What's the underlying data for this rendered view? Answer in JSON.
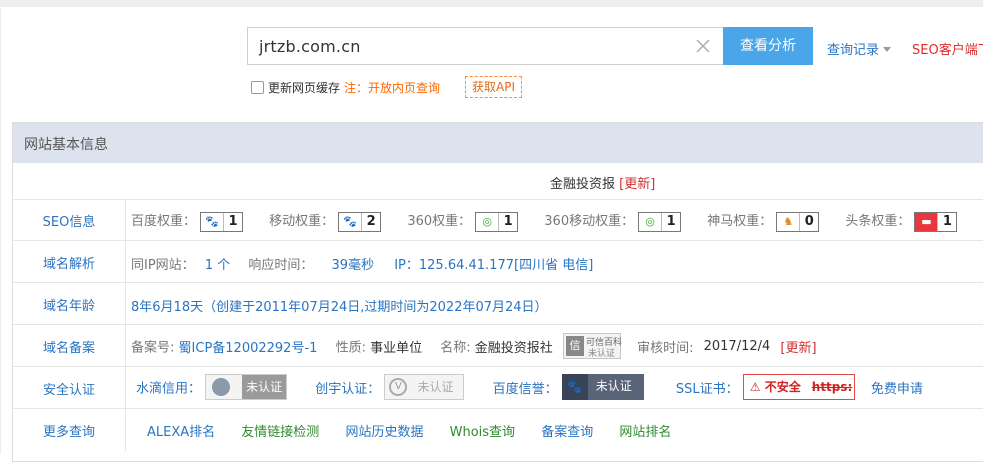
{
  "search": {
    "value": "jrtzb.com.cn",
    "button": "查看分析",
    "history": "查询记录",
    "seo_client": "SEO客户端下"
  },
  "options": {
    "refresh_cache": "更新网页缓存",
    "note": "注：开放内页查询",
    "api": "获取API"
  },
  "panel": {
    "title": "网站基本信息",
    "site_name": "金融投资报",
    "update": "[更新]",
    "rows": {
      "seo": {
        "label": "SEO信息",
        "items": [
          {
            "name": "百度权重：",
            "icon": "baidu-paw-icon",
            "value": "1"
          },
          {
            "name": "移动权重：",
            "icon": "baidu-paw-icon",
            "value": "2"
          },
          {
            "name": "360权重：",
            "icon": "360-icon",
            "value": "1"
          },
          {
            "name": "360移动权重：",
            "icon": "360-icon",
            "value": "1"
          },
          {
            "name": "神马权重：",
            "icon": "shenma-icon",
            "value": "0"
          },
          {
            "name": "头条权重：",
            "icon": "toutiao-icon",
            "value": "1"
          }
        ]
      },
      "domain_resolve": {
        "label": "域名解析",
        "same_ip_label": "同IP网站：",
        "same_ip_value": "1 个",
        "response_label": "响应时间：",
        "response_value": "39毫秒",
        "ip": "IP：125.64.41.177[四川省 电信]"
      },
      "domain_age": {
        "label": "域名年龄",
        "age": "8年6月18天",
        "detail": "（创建于2011年07月24日,过期时间为2022年07月24日）"
      },
      "icp": {
        "label": "域名备案",
        "no_label": "备案号:",
        "no_value": "蜀ICP备12002292号-1",
        "nature_label": "性质:",
        "nature_value": "事业单位",
        "name_label": "名称:",
        "name_value": "金融投资报社",
        "kx_line1": "可信百科",
        "kx_line2": "未认证",
        "audit_label": "审核时间:",
        "audit_value": "2017/12/4",
        "update": "[更新]"
      },
      "security": {
        "label": "安全认证",
        "water_label": "水滴信用：",
        "water_badge": "未认证",
        "chuangyu_label": "创宇认证：",
        "chuangyu_badge": "未认证",
        "baidu_label": "百度信誉：",
        "baidu_badge": "未认证",
        "ssl_label": "SSL证书：",
        "ssl_badge": "不安全",
        "ssl_proto": "https:",
        "free_apply": "免费申请"
      },
      "more": {
        "label": "更多查询",
        "links": [
          "ALEXA排名",
          "友情链接检测",
          "网站历史数据",
          "Whois查询",
          "备案查询",
          "网站排名"
        ]
      }
    }
  },
  "colors": {
    "accent": "#4aa6e8",
    "link": "#2a74c2",
    "red": "#d03030",
    "green": "#2f8a2f",
    "header_bg": "#dde3ee"
  }
}
